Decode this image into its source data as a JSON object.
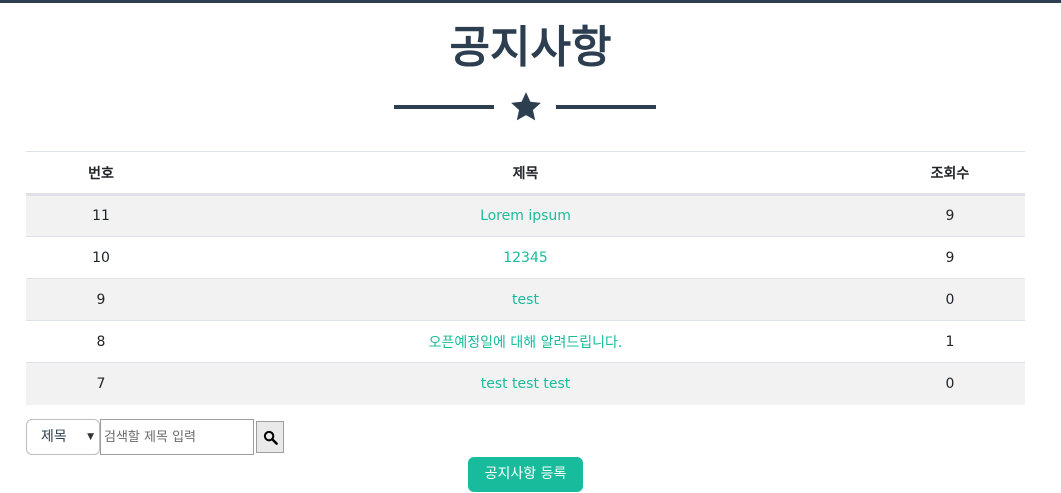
{
  "header": {
    "title": "공지사항"
  },
  "table": {
    "columns": [
      "번호",
      "제목",
      "조회수"
    ],
    "rows": [
      {
        "no": "11",
        "title": "Lorem ipsum",
        "views": "9"
      },
      {
        "no": "10",
        "title": "12345",
        "views": "9"
      },
      {
        "no": "9",
        "title": "test",
        "views": "0"
      },
      {
        "no": "8",
        "title": "오픈예정일에 대해 알려드립니다.",
        "views": "1"
      },
      {
        "no": "7",
        "title": "test test test",
        "views": "0"
      }
    ]
  },
  "search": {
    "select_value": "제목",
    "input_placeholder": "검색할 제목 입력",
    "button_icon": "search-icon"
  },
  "actions": {
    "register_label": "공지사항 등록"
  },
  "colors": {
    "primary": "#2c3e50",
    "accent": "#18bc9c",
    "stripe": "#f2f2f2"
  }
}
